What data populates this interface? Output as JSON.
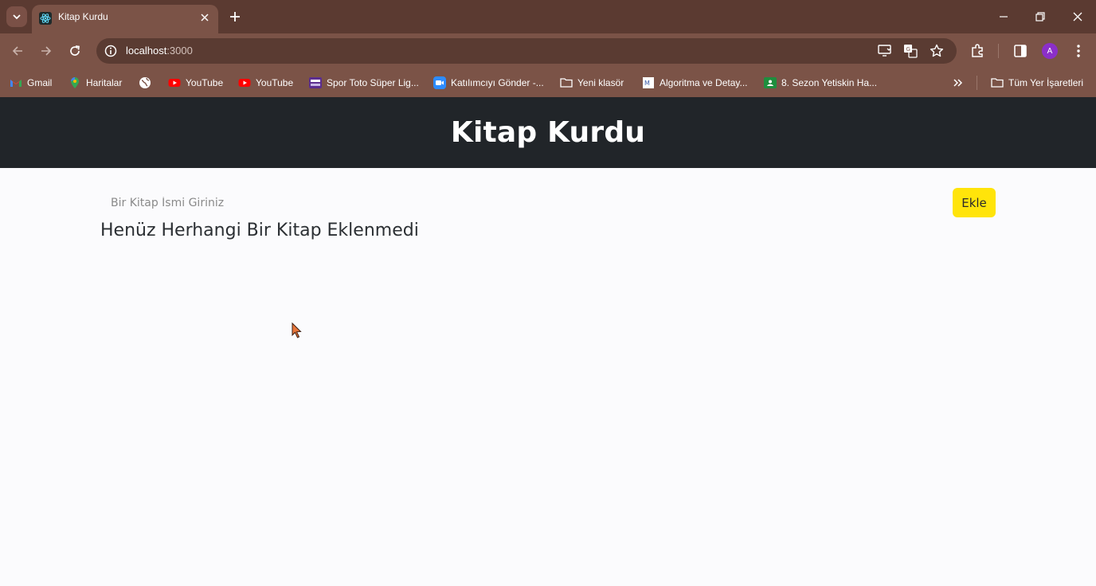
{
  "browser": {
    "tab": {
      "title": "Kitap Kurdu"
    },
    "address": {
      "host": "localhost",
      "port": ":3000"
    },
    "profile_initial": "A",
    "bookmarks": [
      {
        "label": "Gmail",
        "icon": "gmail-icon"
      },
      {
        "label": "Haritalar",
        "icon": "maps-icon"
      },
      {
        "label": "",
        "icon": "globe-icon"
      },
      {
        "label": "YouTube",
        "icon": "youtube-icon"
      },
      {
        "label": "YouTube",
        "icon": "youtube-icon"
      },
      {
        "label": "Spor Toto Süper Lig...",
        "icon": "sport-icon"
      },
      {
        "label": "Katılımcıyı Gönder -...",
        "icon": "zoom-icon"
      },
      {
        "label": "Yeni klasör",
        "icon": "folder-icon"
      },
      {
        "label": "Algoritma ve Detay...",
        "icon": "doc-icon"
      },
      {
        "label": "8. Sezon Yetiskin Ha...",
        "icon": "classroom-icon"
      }
    ],
    "all_bookmarks_label": "Tüm Yer İşaretleri"
  },
  "app": {
    "title": "Kitap Kurdu",
    "input": {
      "placeholder": "Bir Kitap İsmi Giriniz",
      "value": ""
    },
    "add_button": "Ekle",
    "empty_message": "Henüz Herhangi Bir Kitap Eklenmedi"
  },
  "colors": {
    "chrome_dark": "#5b3a31",
    "chrome": "#7b5347",
    "header_bg": "#212529",
    "button_yellow": "#ffe40a",
    "page_bg": "#fbfbfd"
  }
}
